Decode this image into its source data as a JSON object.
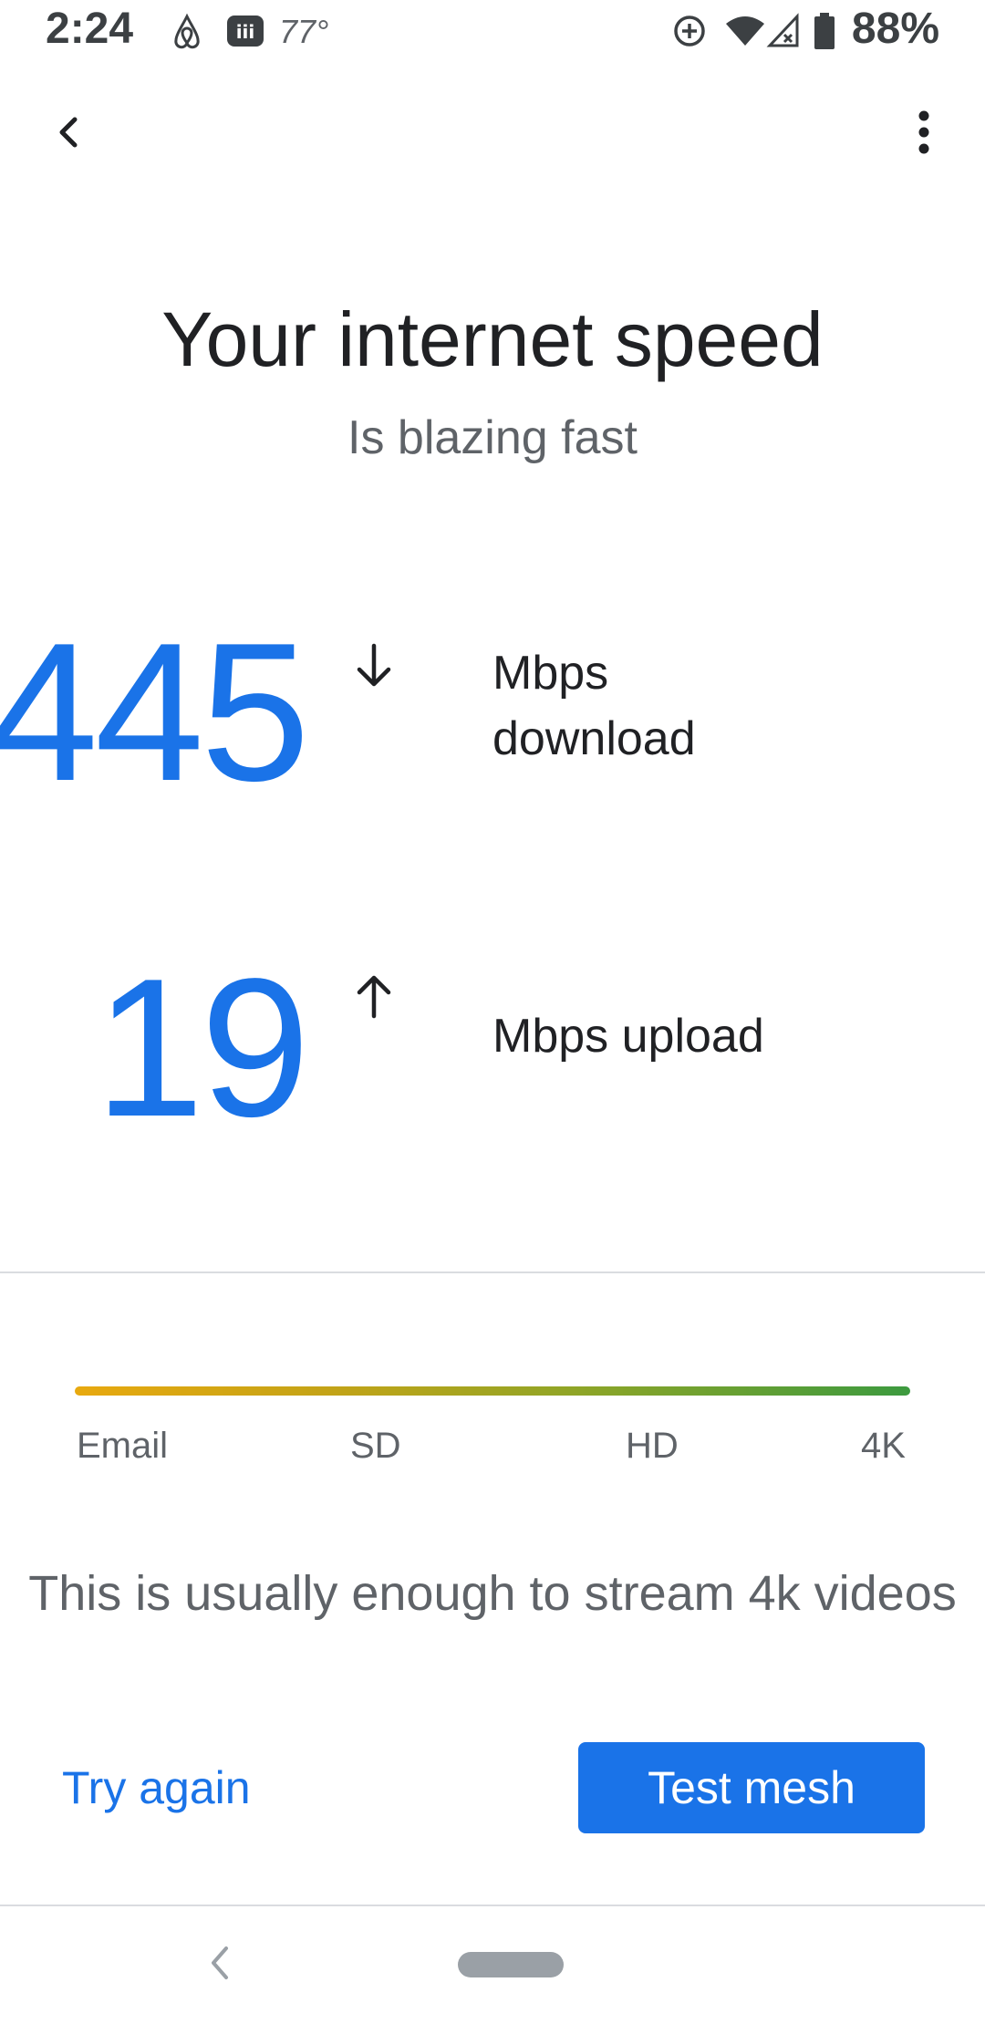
{
  "status_bar": {
    "time": "2:24",
    "temperature": "77°",
    "battery": "88%",
    "icons": [
      "airbnb-icon",
      "news-icon",
      "data-saver-icon",
      "wifi-icon",
      "signal-icon",
      "battery-icon"
    ]
  },
  "header": {
    "back_icon": "back-icon",
    "menu_icon": "more-vert-icon"
  },
  "main": {
    "title": "Your internet speed",
    "subtitle": "Is blazing fast",
    "download": {
      "value": "445",
      "unit_line1": "Mbps",
      "unit_line2": "download",
      "arrow_icon": "arrow-down-icon"
    },
    "upload": {
      "value": "19",
      "unit": "Mbps upload",
      "arrow_icon": "arrow-up-icon"
    }
  },
  "quality_scale": {
    "labels": [
      "Email",
      "SD",
      "HD",
      "4K"
    ],
    "colors": {
      "start": "#e8a90f",
      "end": "#3c9a3f"
    }
  },
  "message": "This is usually enough to stream 4k videos",
  "actions": {
    "try_again": "Try again",
    "test_mesh": "Test mesh"
  },
  "nav_bar": {
    "back_icon": "nav-back-icon",
    "home_icon": "home-pill-icon"
  },
  "colors": {
    "accent": "#1a73e8",
    "text": "#202124",
    "secondary_text": "#5f6368"
  }
}
